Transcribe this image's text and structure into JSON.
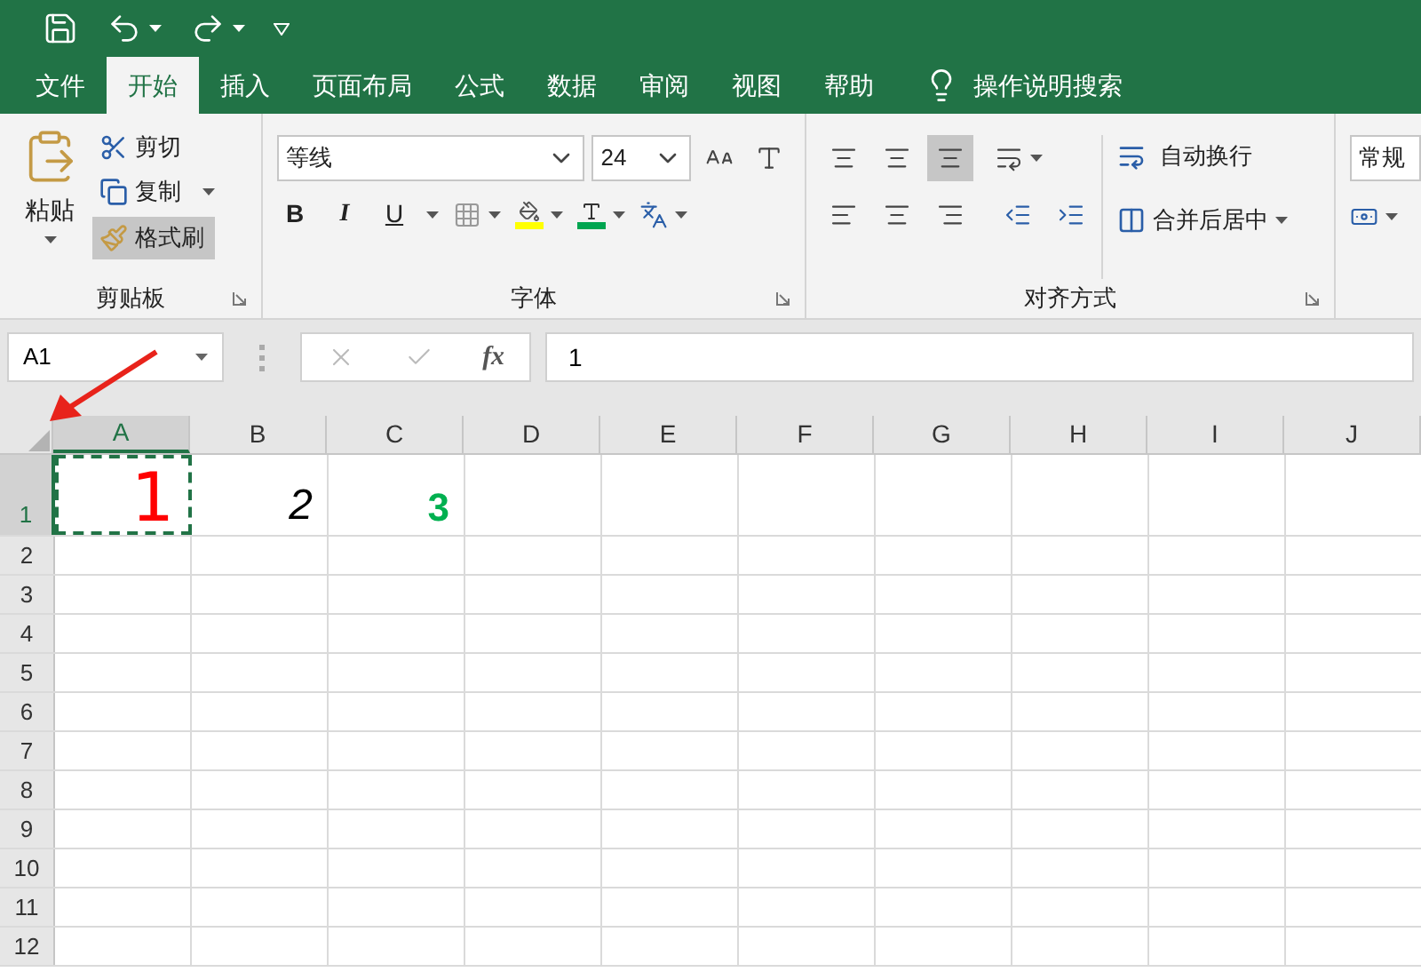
{
  "tabs": [
    {
      "label": "文件",
      "selected": false
    },
    {
      "label": "开始",
      "selected": true
    },
    {
      "label": "插入",
      "selected": false
    },
    {
      "label": "页面布局",
      "selected": false
    },
    {
      "label": "公式",
      "selected": false
    },
    {
      "label": "数据",
      "selected": false
    },
    {
      "label": "审阅",
      "selected": false
    },
    {
      "label": "视图",
      "selected": false
    },
    {
      "label": "帮助",
      "selected": false
    }
  ],
  "tell_me": "操作说明搜索",
  "clipboard": {
    "paste": "粘贴",
    "cut": "剪切",
    "copy": "复制",
    "format_painter": {
      "label": "格式刷",
      "active": true
    },
    "group_label": "剪贴板"
  },
  "font": {
    "name": "等线",
    "size": "24",
    "bold": "B",
    "italic": "I",
    "underline": "U",
    "group_label": "字体"
  },
  "alignment": {
    "bottom_align_active": true,
    "wrap": "自动换行",
    "merge": "合并后居中",
    "group_label": "对齐方式"
  },
  "number": {
    "format": "常规"
  },
  "formula_bar": {
    "name_box": "A1",
    "fx": "fx",
    "value": "1"
  },
  "columns": [
    {
      "label": "A",
      "selected": true
    },
    {
      "label": "B",
      "selected": false
    },
    {
      "label": "C",
      "selected": false
    },
    {
      "label": "D",
      "selected": false
    },
    {
      "label": "E",
      "selected": false
    },
    {
      "label": "F",
      "selected": false
    },
    {
      "label": "G",
      "selected": false
    },
    {
      "label": "H",
      "selected": false
    },
    {
      "label": "I",
      "selected": false
    },
    {
      "label": "J",
      "selected": false
    }
  ],
  "rows": [
    {
      "label": "1",
      "selected": true,
      "cells": [
        {
          "text": "1",
          "kind": "large",
          "color": "#ff0000",
          "selected": true
        },
        {
          "text": "2",
          "kind": "italic",
          "color": "#000000",
          "selected": false
        },
        {
          "text": "3",
          "kind": "bold",
          "color": "#00b050",
          "selected": false
        }
      ]
    },
    {
      "label": "2",
      "selected": false,
      "cells": []
    },
    {
      "label": "3",
      "selected": false,
      "cells": []
    },
    {
      "label": "4",
      "selected": false,
      "cells": []
    },
    {
      "label": "5",
      "selected": false,
      "cells": []
    },
    {
      "label": "6",
      "selected": false,
      "cells": []
    },
    {
      "label": "7",
      "selected": false,
      "cells": []
    },
    {
      "label": "8",
      "selected": false,
      "cells": []
    },
    {
      "label": "9",
      "selected": false,
      "cells": []
    },
    {
      "label": "10",
      "selected": false,
      "cells": []
    },
    {
      "label": "11",
      "selected": false,
      "cells": []
    },
    {
      "label": "12",
      "selected": false,
      "cells": []
    }
  ]
}
